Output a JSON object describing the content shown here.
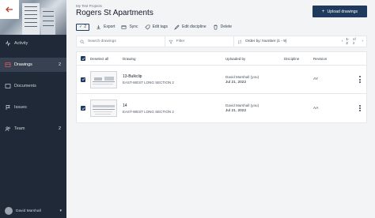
{
  "sidebar": {
    "items": [
      {
        "label": "Activity",
        "icon": "activity-icon",
        "count": ""
      },
      {
        "label": "Drawings",
        "icon": "drawings-icon",
        "count": "2",
        "active": true
      },
      {
        "label": "Documents",
        "icon": "documents-icon",
        "count": ""
      },
      {
        "label": "Issues",
        "icon": "issues-icon",
        "count": ""
      },
      {
        "label": "Team",
        "icon": "team-icon",
        "count": "2"
      }
    ],
    "user_name": "David Marshall",
    "user_chevron": "▾"
  },
  "header": {
    "project": "My Test Projects",
    "title": "Rogers St Apartments",
    "upload_label": "Upload drawings"
  },
  "toolbar": {
    "selected_count": "2",
    "export": "Export",
    "sync": "Sync",
    "edit_tags": "Edit tags",
    "edit_discipline": "Edit discipline",
    "delete": "Delete"
  },
  "filters": {
    "search_placeholder": "Search drawings",
    "filter_label": "Filter",
    "order_label": "Order by: Number (1 - 9)",
    "page_range": "1-2",
    "page_of": "of 2"
  },
  "table": {
    "headers": {
      "select": "Deselect all",
      "drawing": "Drawing",
      "uploaded": "Uploaded by",
      "discipline": "Discipline",
      "revision": "Revision"
    },
    "rows": [
      {
        "number": "13-Bulkclip",
        "desc": "EAST-WEST LONG SECTION 2",
        "uploader": "David Marshall (you)",
        "date": "Jul 21, 2022",
        "discipline": "",
        "revision": "AY"
      },
      {
        "number": "14",
        "desc": "EAST-WEST LONG SECTION 2",
        "uploader": "David Marshall (you)",
        "date": "Jul 21, 2022",
        "discipline": "",
        "revision": "AA"
      }
    ]
  },
  "colors": {
    "sidebar_bg": "#1f2937",
    "accent": "#1e3a5f",
    "back_arrow": "#c0392b"
  }
}
